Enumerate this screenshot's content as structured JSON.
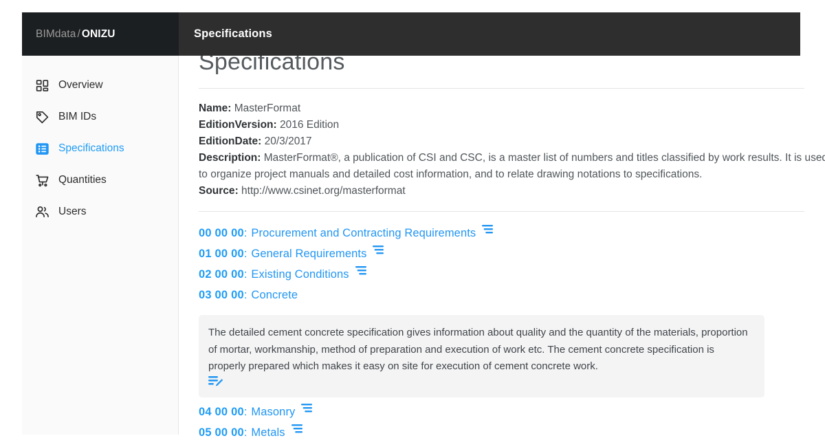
{
  "topbar": {
    "brand_org": "BIMdata",
    "brand_separator": "/",
    "brand_project": "ONIZU",
    "title": "Specifications"
  },
  "sidebar": {
    "items": [
      {
        "label": "Overview",
        "icon": "grid-icon",
        "active": false
      },
      {
        "label": "BIM IDs",
        "icon": "tag-icon",
        "active": false
      },
      {
        "label": "Specifications",
        "icon": "list-box-icon",
        "active": true
      },
      {
        "label": "Quantities",
        "icon": "cart-icon",
        "active": false
      },
      {
        "label": "Users",
        "icon": "users-icon",
        "active": false
      }
    ]
  },
  "page": {
    "title": "Specifications",
    "meta": [
      {
        "key": "Name",
        "value": "MasterFormat"
      },
      {
        "key": "EditionVersion",
        "value": "2016 Edition"
      },
      {
        "key": "EditionDate",
        "value": "20/3/2017"
      },
      {
        "key": "Description",
        "value": "MasterFormat®, a publication of CSI and CSC, is a master list of numbers and titles classified by work results. It is used to organize project manuals and detailed cost information, and to relate drawing notations to specifications."
      },
      {
        "key": "Source",
        "value": "http://www.csinet.org/masterformat"
      }
    ],
    "specifications": [
      {
        "code": "00 00 00",
        "separator": ":",
        "name": "Procurement and Contracting Requirements",
        "has_note_icon": true,
        "description": null
      },
      {
        "code": "01 00 00",
        "separator": ":",
        "name": "General Requirements",
        "has_note_icon": true,
        "description": null
      },
      {
        "code": "02 00 00",
        "separator": ":",
        "name": "Existing Conditions",
        "has_note_icon": true,
        "description": null
      },
      {
        "code": "03 00 00",
        "separator": ":",
        "name": "Concrete",
        "has_note_icon": false,
        "description": "The detailed cement concrete specification gives information about quality and the quantity of the materials, proportion of mortar, workmanship, method of preparation and execution of work etc. The cement concrete specification is properly prepared which makes it easy on site for execution of cement concrete work."
      },
      {
        "code": "04 00 00",
        "separator": ":",
        "name": "Masonry",
        "has_note_icon": true,
        "description": null
      },
      {
        "code": "05 00 00",
        "separator": ":",
        "name": "Metals",
        "has_note_icon": true,
        "description": null
      }
    ]
  },
  "colors": {
    "accent_blue": "#2196f3",
    "code_blue": "#1f9cf5",
    "topbar_brand_bg": "#1c1f21",
    "topbar_main_bg": "#2e2e2e",
    "sidebar_bg": "#fafafa",
    "panel_bg": "#f4f4f5"
  }
}
